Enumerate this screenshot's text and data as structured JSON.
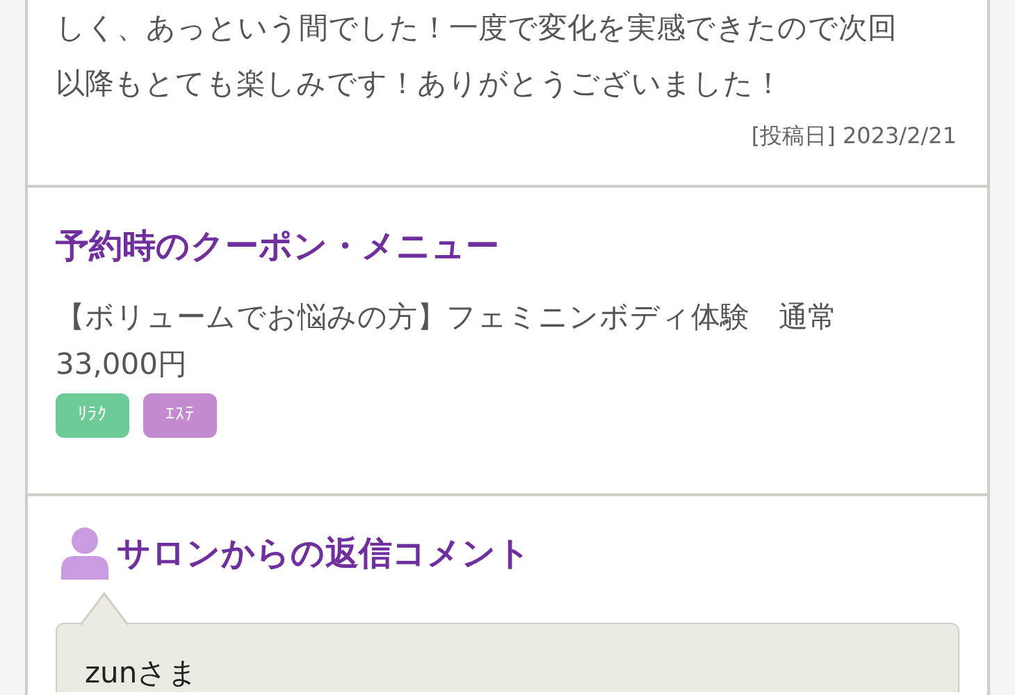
{
  "review": {
    "lines": [
      "しく、あっという間でした！一度で変化を実感できたので次回",
      "以降もとても楽しみです！ありがとうございました！"
    ],
    "posted": "[投稿日] 2023/2/21"
  },
  "coupon": {
    "title": "予約時のクーポン・メニュー",
    "menu": "【ボリュームでお悩みの方】フェミニンボディ体験　通常 33,000円",
    "tags": [
      {
        "label": "ﾘﾗｸ",
        "color": "#6dcb98"
      },
      {
        "label": "ｴｽﾃ",
        "color": "#c48ad0"
      }
    ]
  },
  "reply": {
    "title": "サロンからの返信コメント",
    "greeting": "zunさま"
  }
}
